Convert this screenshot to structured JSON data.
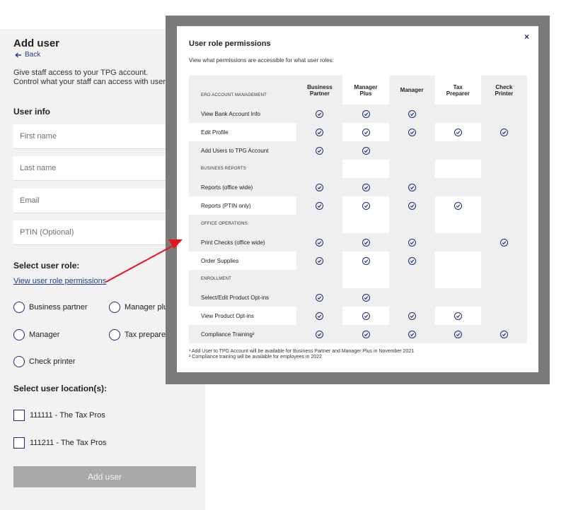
{
  "form": {
    "title": "Add user",
    "back_label": "Back",
    "intro_line1": "Give staff access to your TPG account.",
    "intro_line2": "Control what your staff can access with user",
    "user_info_label": "User info",
    "fields": {
      "first_name": "First name",
      "last_name": "Last name",
      "email": "Email",
      "ptin": "PTIN (Optional)"
    },
    "select_role_label": "Select user role:",
    "permissions_link": "View user role permissions",
    "roles": [
      "Business partner",
      "Manager plu",
      "Manager",
      "Tax prepare",
      "Check printer"
    ],
    "select_location_label": "Select user location(s):",
    "locations": [
      "111111 - The Tax Pros",
      "111211 - The Tax Pros"
    ],
    "add_button": "Add user"
  },
  "modal": {
    "title": "User role permissions",
    "close": "×",
    "subtitle": "View what permissions are accessible for what user roles:",
    "header_section": "ERO ACCOUNT MANAGEMENT",
    "columns": [
      {
        "line1": "Business",
        "line2": "Partner"
      },
      {
        "line1": "Manager",
        "line2": "Plus"
      },
      {
        "line1": "Manager",
        "line2": ""
      },
      {
        "line1": "Tax",
        "line2": "Preparer"
      },
      {
        "line1": "Check",
        "line2": "Printer"
      }
    ],
    "rows": [
      {
        "label": "View Bank Account Info",
        "checks": [
          true,
          true,
          true,
          false,
          false
        ]
      },
      {
        "label": "Edit Profile",
        "checks": [
          true,
          true,
          true,
          true,
          true
        ]
      },
      {
        "label": "Add Users to TPG Account",
        "checks": [
          true,
          true,
          false,
          false,
          false
        ]
      },
      {
        "section": "BUSINESS REPORTS"
      },
      {
        "label": "Reports (office wide)",
        "checks": [
          true,
          true,
          true,
          false,
          false
        ]
      },
      {
        "label": "Reports (PTIN only)",
        "checks": [
          true,
          true,
          true,
          true,
          false
        ]
      },
      {
        "section": "OFFICE OPERATIONS"
      },
      {
        "label": "Print Checks (office wide)",
        "checks": [
          true,
          true,
          true,
          false,
          true
        ]
      },
      {
        "label": "Order Supplies",
        "checks": [
          true,
          true,
          true,
          false,
          false
        ]
      },
      {
        "section": "ENROLLMENT"
      },
      {
        "label": "Select/Edit Product Opt-ins",
        "checks": [
          true,
          true,
          false,
          false,
          false
        ]
      },
      {
        "label": "View Product Opt-ins",
        "checks": [
          true,
          true,
          true,
          true,
          false
        ]
      },
      {
        "label": "Compliance Training²",
        "checks": [
          true,
          true,
          true,
          true,
          true
        ]
      }
    ],
    "footnote1": "¹ Add User to TPG Account will be available for Business Partner and Manager Plus in November 2021",
    "footnote2": "² Compliance training will be available for employees in 2022"
  },
  "colors": {
    "accent": "#1e2a78",
    "link": "#2b3a8f",
    "arrow": "#e8141b",
    "panel_bg": "#f2f2f2",
    "modal_frame": "#7a7a7a",
    "row_shade": "#efefef",
    "button_disabled": "#a9a9a9"
  }
}
